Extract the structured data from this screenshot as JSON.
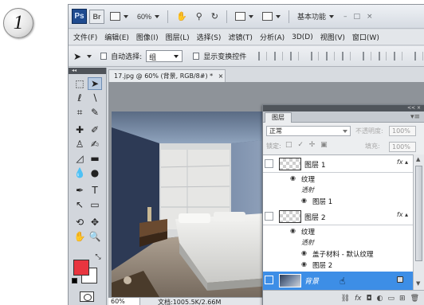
{
  "step_number": "1",
  "title_bar": {
    "app_logo": "Ps",
    "bridge_logo": "Br",
    "zoom": "60%",
    "workspace": "基本功能",
    "window_controls": [
      "–",
      "□",
      "×"
    ]
  },
  "menu": [
    "文件(F)",
    "编辑(E)",
    "图像(I)",
    "图层(L)",
    "选择(S)",
    "滤镜(T)",
    "分析(A)",
    "3D(D)",
    "视图(V)",
    "窗口(W)"
  ],
  "options_bar": {
    "auto_select_label": "自动选择:",
    "auto_select_value": "组",
    "show_transform_label": "显示变换控件"
  },
  "document": {
    "tab_title": "17.jpg @ 60% (背景, RGB/8#) *",
    "close_glyph": "×",
    "zoom_status": "60%",
    "doc_info": "文档:1005.5K/2.66M"
  },
  "layers_panel": {
    "collapse_glyph": "<< ×",
    "tab_label": "图层",
    "menu_glyph": "▾≡",
    "blend_mode": "正常",
    "opacity_label": "不透明度:",
    "opacity_value": "100%",
    "lock_label": "锁定:",
    "lock_glyphs": "□ ✓ ✢ ▣",
    "fill_label": "填充:",
    "fill_value": "100%",
    "layers": [
      {
        "name": "图层 1",
        "effects_label": "纹理",
        "blend_label": "透射",
        "sub_items": [
          "图层 1"
        ]
      },
      {
        "name": "图层 2",
        "effects_label": "纹理",
        "blend_label": "透射",
        "sub_items": [
          "盖子材料 - 默认纹理",
          "图层 2"
        ]
      },
      {
        "name": "背景",
        "selected": true
      }
    ],
    "footer_icons": [
      "link-icon",
      "fx-icon",
      "mask-icon",
      "adjustment-icon",
      "folder-icon",
      "new-layer-icon",
      "trash-icon"
    ],
    "footer_glyphs": [
      "⛓",
      "fx",
      "◘",
      "◐",
      "▭",
      "⊞",
      "🗑"
    ]
  },
  "colors": {
    "foreground": "#e8353f",
    "background": "#ffffff",
    "selection": "#3d8ee6"
  }
}
